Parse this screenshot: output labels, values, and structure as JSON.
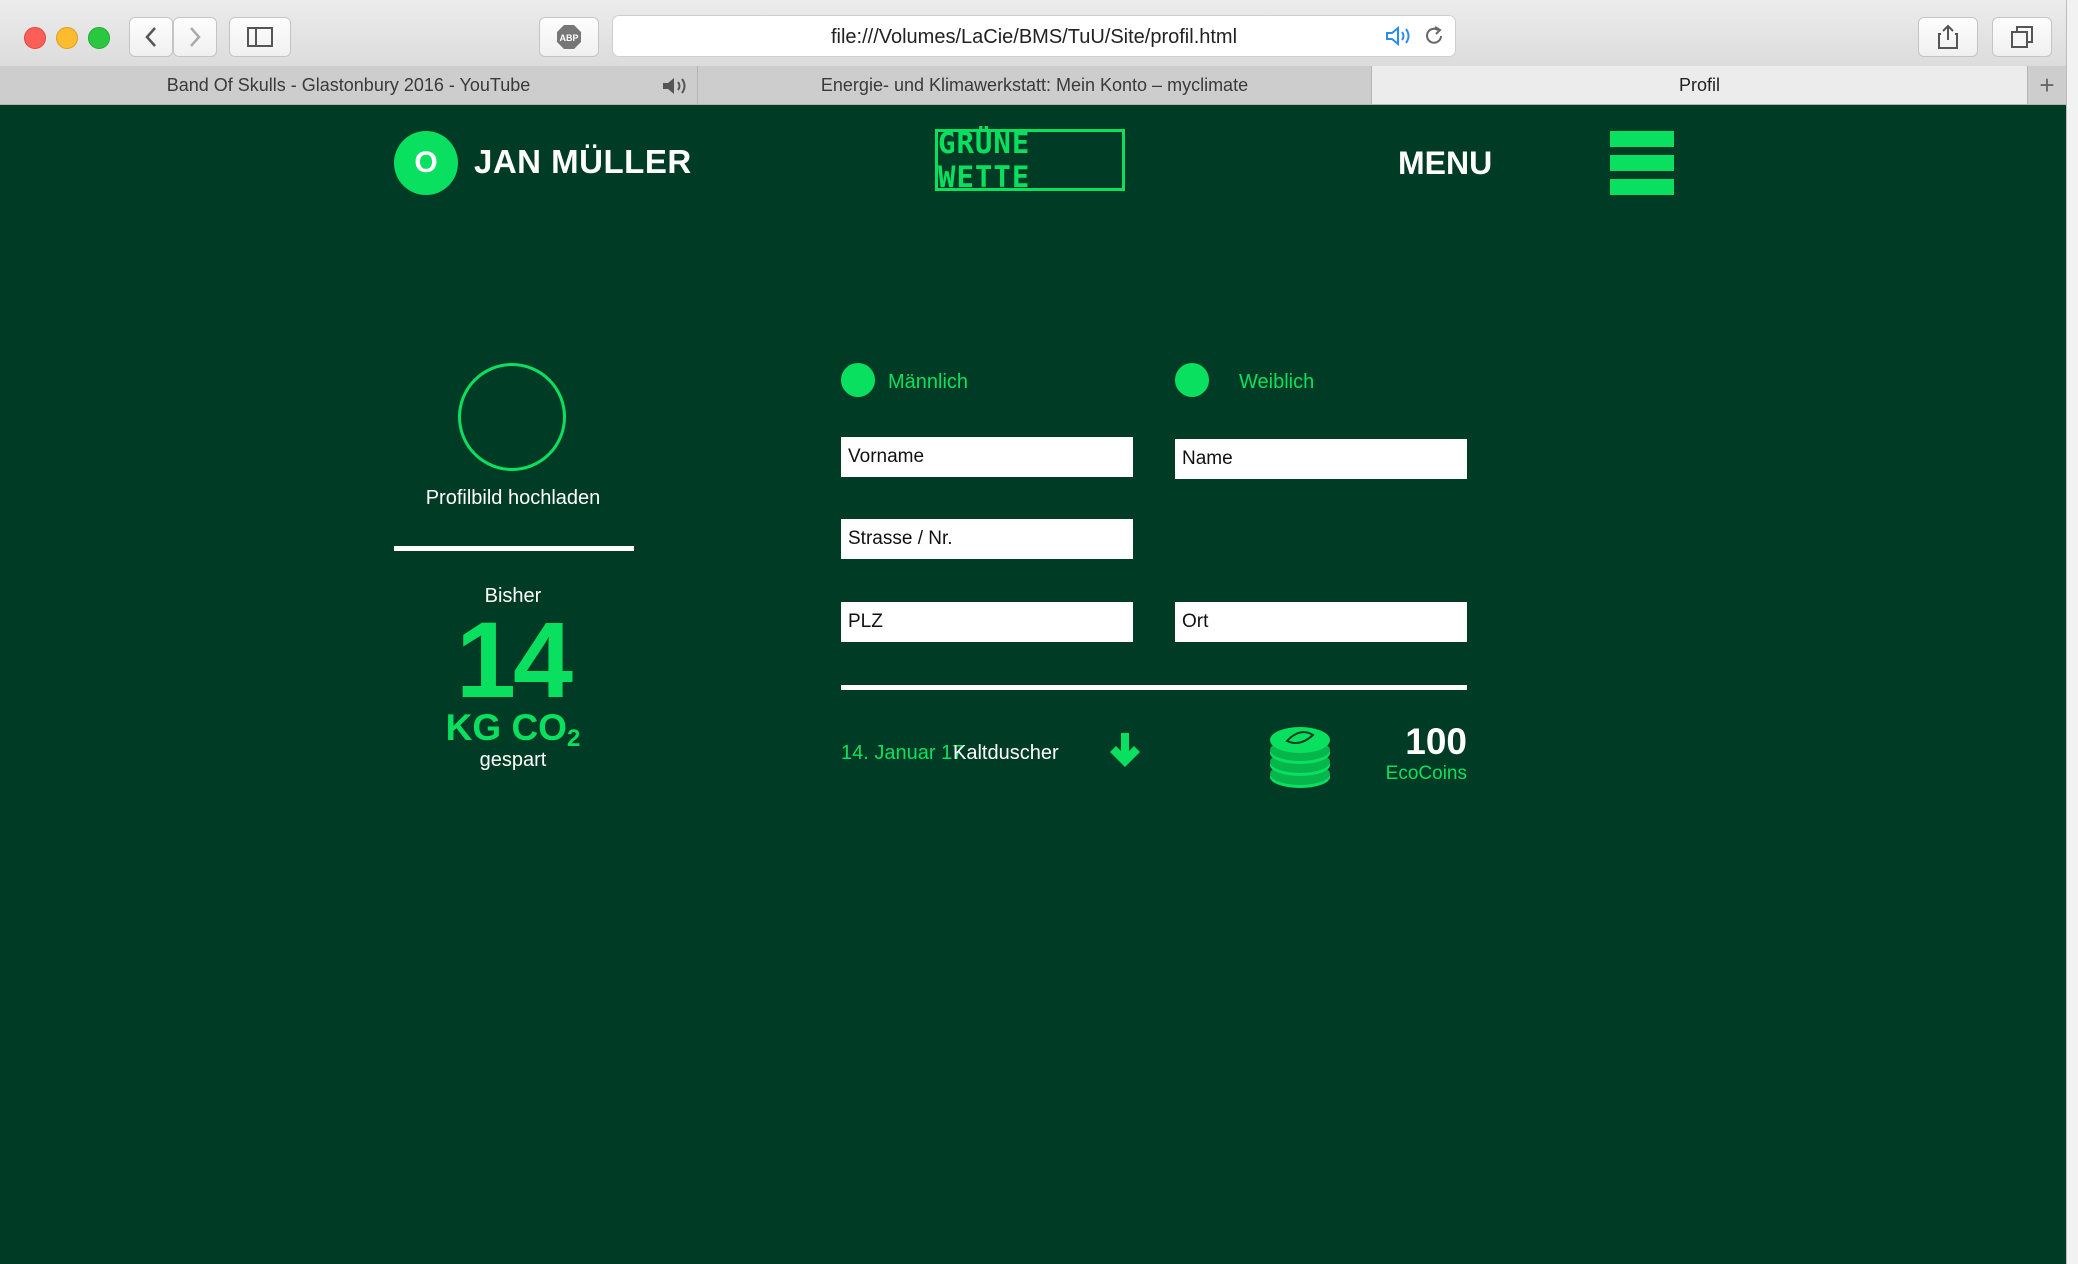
{
  "browser": {
    "url": "file:///Volumes/LaCie/BMS/TuU/Site/profil.html",
    "tabs": [
      {
        "label": "Band Of Skulls - Glastonbury 2016 - YouTube"
      },
      {
        "label": "Energie- und Klimawerkstatt: Mein Konto – myclimate"
      },
      {
        "label": "Profil"
      }
    ],
    "new_tab": "+"
  },
  "header": {
    "initial": "O",
    "user_name": "JAN MÜLLER",
    "logo": "GRÜNE WETTE",
    "menu_label": "MENU"
  },
  "profile": {
    "upload_label": "Profilbild hochladen",
    "bisher": "Bisher",
    "saved_value": "14",
    "unit_main": "KG CO",
    "unit_sub": "2",
    "gespart": "gespart"
  },
  "form": {
    "gender_male": "Männlich",
    "gender_female": "Weiblich",
    "first_name_placeholder": "Vorname",
    "last_name_placeholder": "Name",
    "street_placeholder": "Strasse / Nr.",
    "zip_placeholder": "PLZ",
    "city_placeholder": "Ort"
  },
  "activity": {
    "date": "14. Januar 17",
    "name": "Kaltduscher"
  },
  "coins": {
    "count": "100",
    "label": "EcoCoins"
  },
  "colors": {
    "background": "#003c25",
    "accent": "#0ae05f",
    "text": "#ffffff"
  }
}
